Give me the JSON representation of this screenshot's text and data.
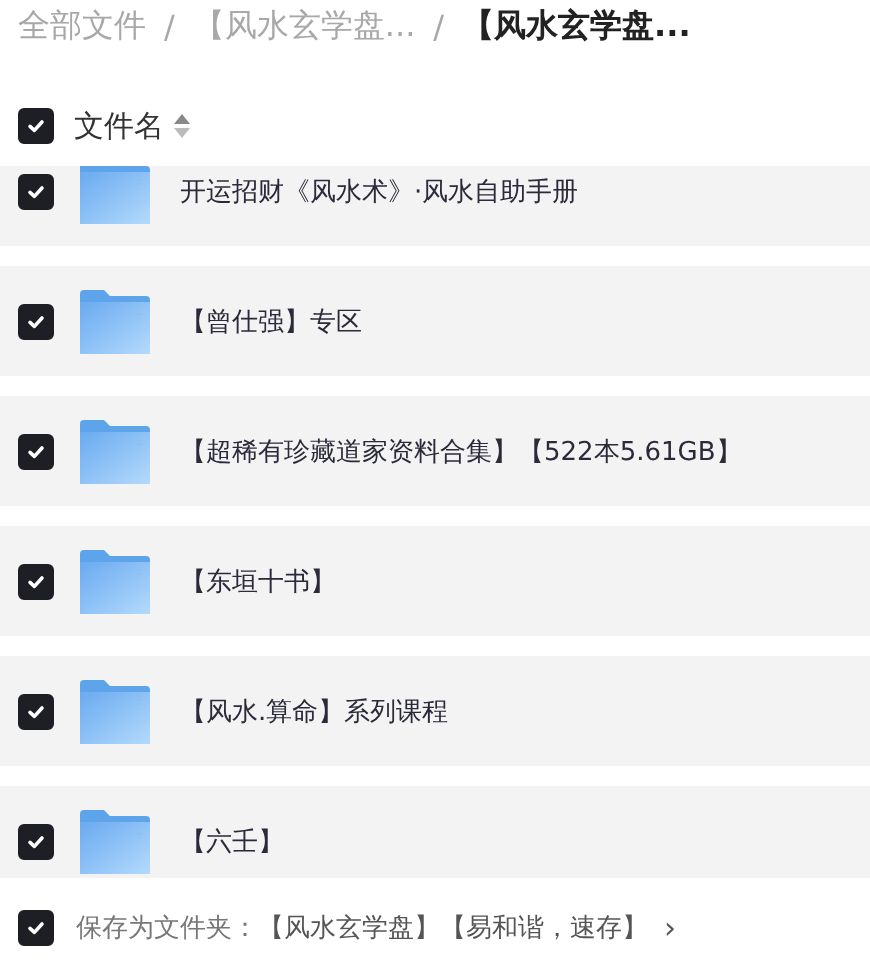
{
  "breadcrumb": {
    "separator": "/",
    "items": [
      {
        "label": "全部文件",
        "current": false
      },
      {
        "label": "【风水玄学盘...",
        "current": false
      },
      {
        "label": "【风水玄学盘...",
        "current": true
      }
    ]
  },
  "header": {
    "checked": true,
    "label": "文件名"
  },
  "rows": [
    {
      "name": "开运招财《风水术》·风水自助手册",
      "checked": true
    },
    {
      "name": "【曾仕强】专区",
      "checked": true
    },
    {
      "name": "【超稀有珍藏道家资料合集】【522本5.61GB】",
      "checked": true
    },
    {
      "name": "【东垣十书】",
      "checked": true
    },
    {
      "name": "【风水.算命】系列课程",
      "checked": true
    },
    {
      "name": "【六壬】",
      "checked": true
    }
  ],
  "footer": {
    "checked": true,
    "label": "保存为文件夹：",
    "path": "【风水玄学盘】【易和谐，速存】",
    "chevron": "›"
  }
}
